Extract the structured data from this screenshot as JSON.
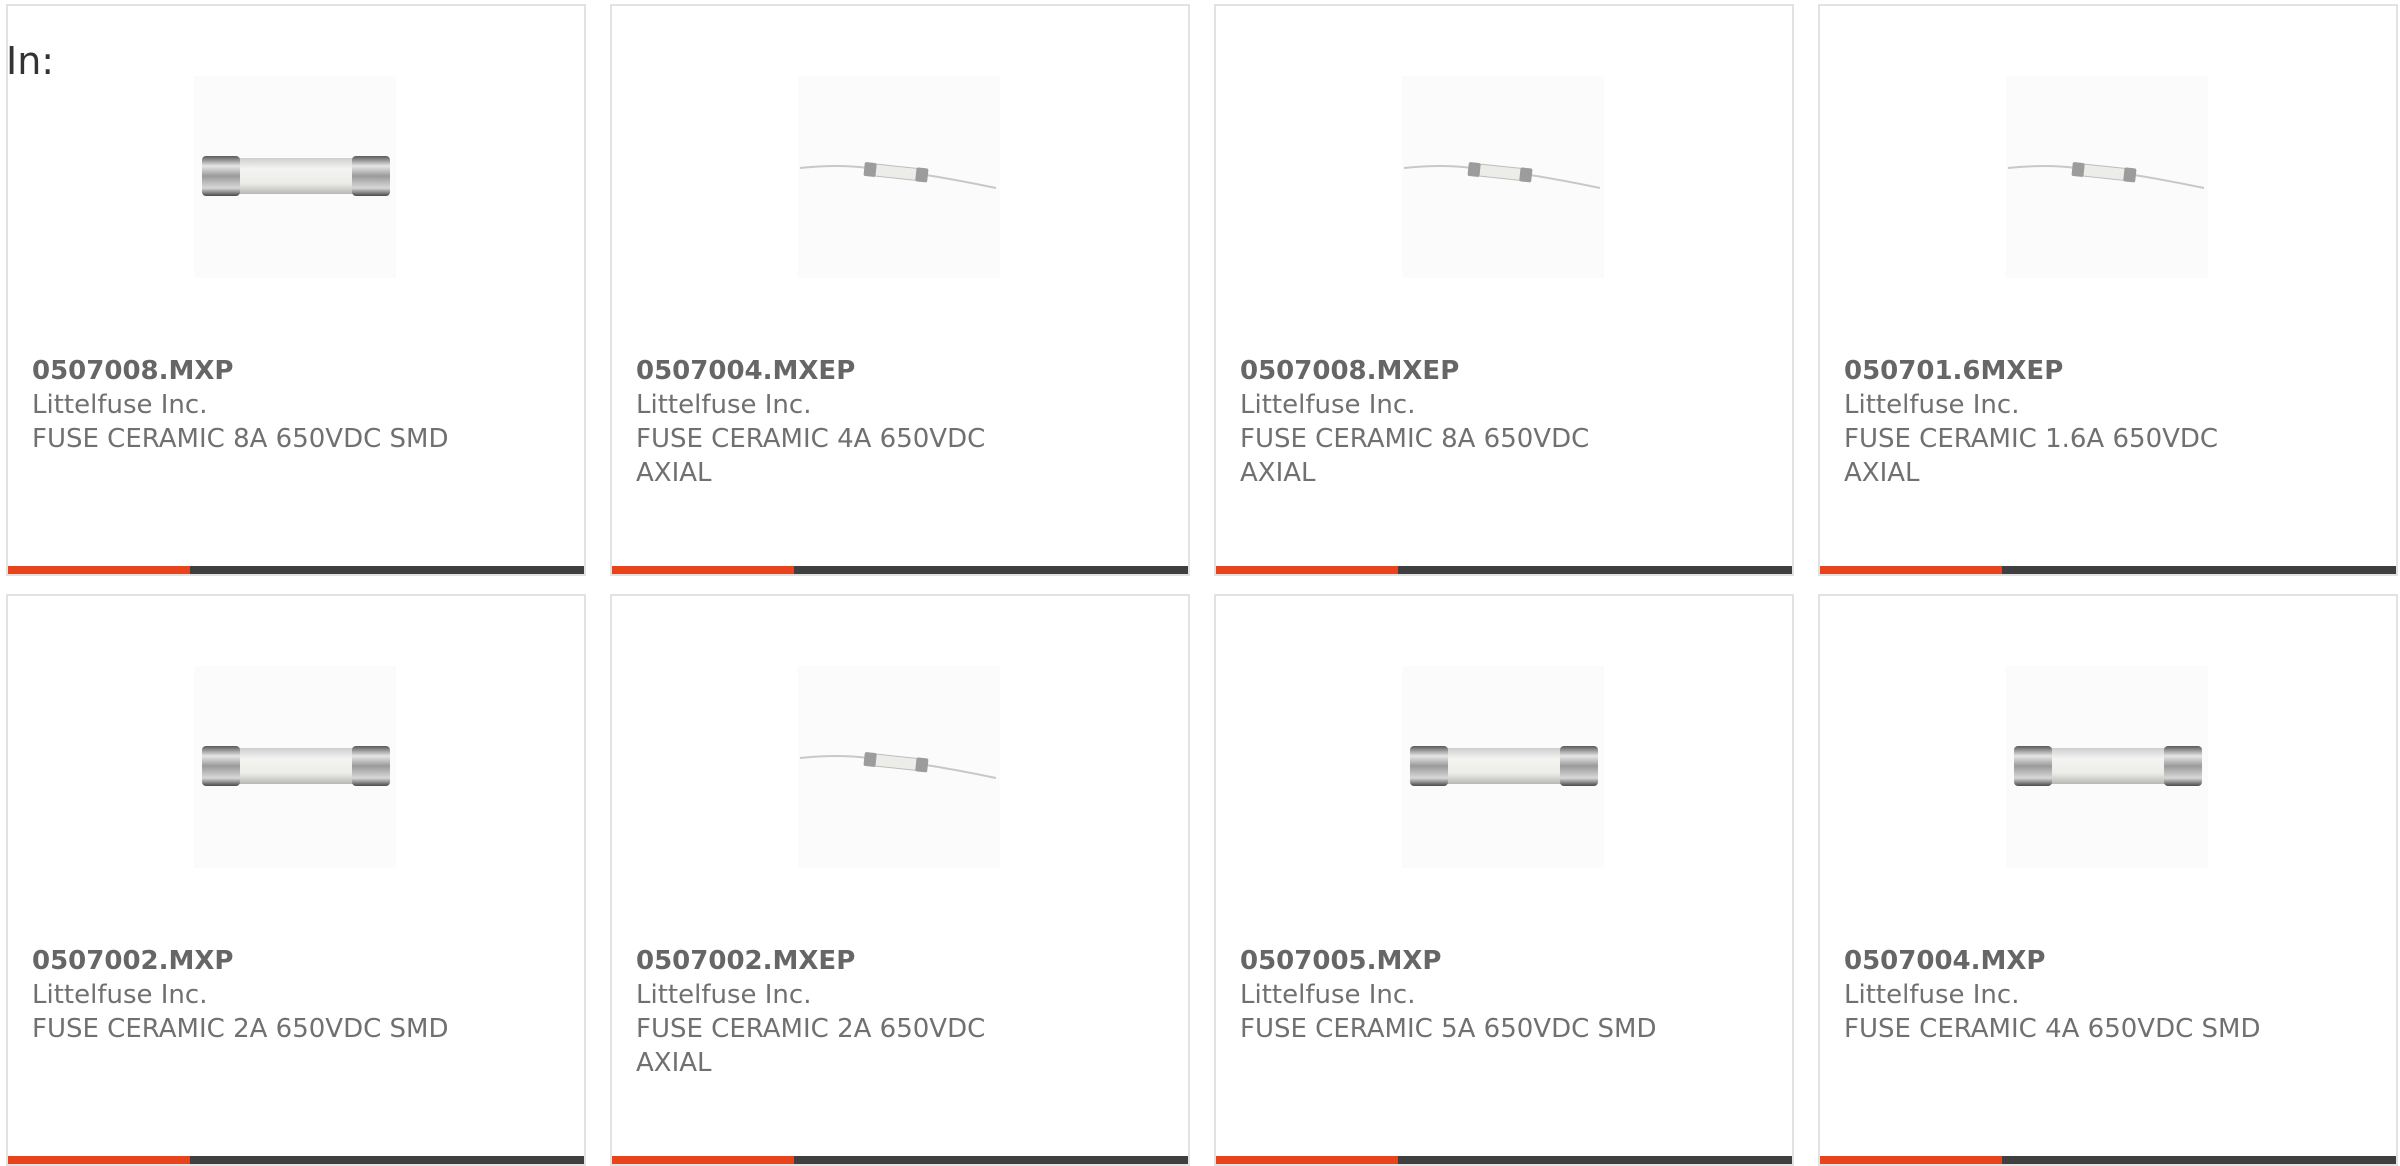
{
  "in_label": "In:",
  "accent_color": "#e8431a",
  "bar_color": "#3f3f3f",
  "products": [
    {
      "part_number": "0507008.MXP",
      "manufacturer": "Littelfuse Inc.",
      "description": "FUSE CERAMIC 8A 650VDC SMD",
      "image_icon": "cartridge-fuse-icon"
    },
    {
      "part_number": "0507004.MXEP",
      "manufacturer": "Littelfuse Inc.",
      "description": "FUSE CERAMIC 4A 650VDC AXIAL",
      "image_icon": "axial-fuse-icon"
    },
    {
      "part_number": "0507008.MXEP",
      "manufacturer": "Littelfuse Inc.",
      "description": "FUSE CERAMIC 8A 650VDC AXIAL",
      "image_icon": "axial-fuse-icon"
    },
    {
      "part_number": "050701.6MXEP",
      "manufacturer": "Littelfuse Inc.",
      "description": "FUSE CERAMIC 1.6A 650VDC AXIAL",
      "image_icon": "axial-fuse-icon"
    },
    {
      "part_number": "0507002.MXP",
      "manufacturer": "Littelfuse Inc.",
      "description": "FUSE CERAMIC 2A 650VDC SMD",
      "image_icon": "cartridge-fuse-icon"
    },
    {
      "part_number": "0507002.MXEP",
      "manufacturer": "Littelfuse Inc.",
      "description": "FUSE CERAMIC 2A 650VDC AXIAL",
      "image_icon": "axial-fuse-icon"
    },
    {
      "part_number": "0507005.MXP",
      "manufacturer": "Littelfuse Inc.",
      "description": "FUSE CERAMIC 5A 650VDC SMD",
      "image_icon": "cartridge-fuse-icon"
    },
    {
      "part_number": "0507004.MXP",
      "manufacturer": "Littelfuse Inc.",
      "description": "FUSE CERAMIC 4A 650VDC SMD",
      "image_icon": "cartridge-fuse-icon"
    }
  ]
}
